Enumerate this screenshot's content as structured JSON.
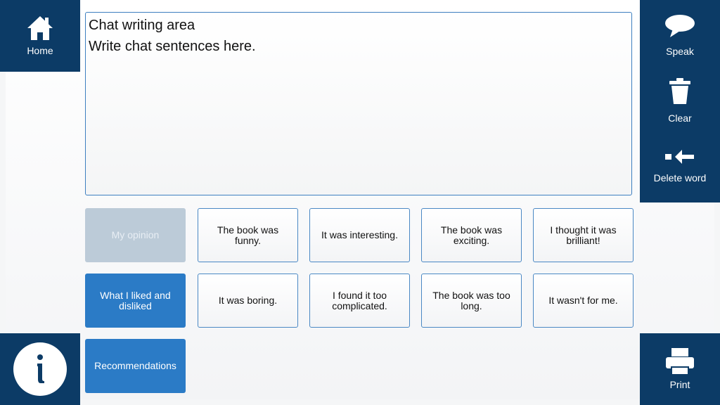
{
  "left_nav": {
    "home_label": "Home",
    "home_icon": "home-icon",
    "info_icon": "info-icon"
  },
  "right_panel": {
    "speak_label": "Speak",
    "speak_icon": "speech-bubble-icon",
    "clear_label": "Clear",
    "clear_icon": "trash-icon",
    "delete_label": "Delete word",
    "delete_icon": "backspace-arrow-icon",
    "print_label": "Print",
    "print_icon": "printer-icon"
  },
  "chat": {
    "title": "Chat writing area",
    "placeholder": "Write chat sentences here."
  },
  "categories": [
    {
      "label": "My opinion",
      "state": "selected"
    },
    {
      "label": "What I liked and disliked",
      "state": "normal"
    },
    {
      "label": "Recommendations",
      "state": "normal"
    }
  ],
  "phrases": [
    [
      "The book was funny.",
      "It was interesting.",
      "The book was exciting.",
      "I thought it was brilliant!"
    ],
    [
      "It was boring.",
      "I found it too complicated.",
      "The book was too long.",
      "It wasn't for me."
    ]
  ],
  "colors": {
    "navy": "#0c3b66",
    "category_blue": "#2b7bc6",
    "category_selected": "#bccbd8",
    "tile_border": "#4a88c4"
  }
}
